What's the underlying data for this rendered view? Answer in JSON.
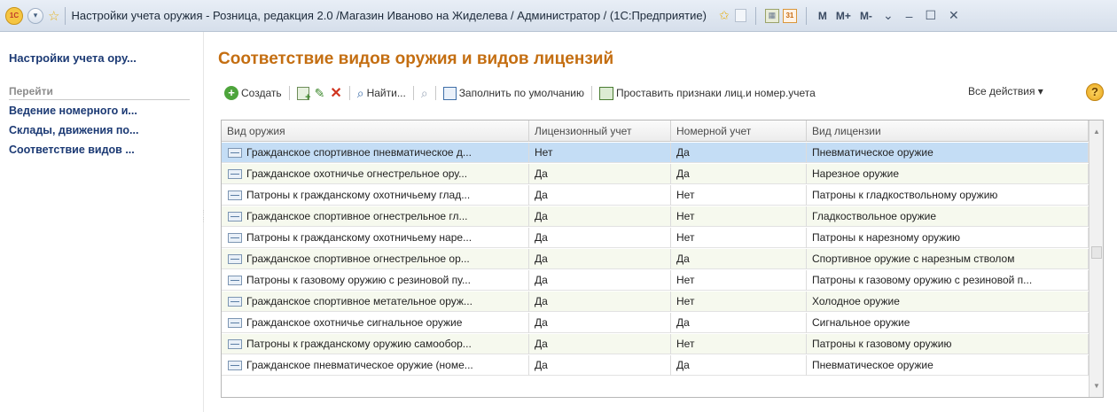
{
  "window": {
    "title": "Настройки учета оружия - Розница, редакция 2.0 /Магазин Иваново на Жиделева / Администратор / (1С:Предприятие)",
    "logo_text": "1С",
    "mem_buttons": [
      "M",
      "M+",
      "M-"
    ]
  },
  "sidebar": {
    "title": "Настройки учета ору...",
    "goto_label": "Перейти",
    "links": [
      "Ведение номерного и...",
      "Склады, движения по...",
      "Соответствие видов ..."
    ]
  },
  "main": {
    "heading": "Соответствие видов оружия и видов лицензий",
    "toolbar": {
      "create": "Создать",
      "find": "Найти...",
      "fill_default": "Заполнить по умолчанию",
      "set_marks": "Проставить признаки лиц.и номер.учета",
      "all_actions": "Все действия ▾",
      "help": "?"
    },
    "columns": [
      "Вид оружия",
      "Лицензионный учет",
      "Номерной учет",
      "Вид лицензии"
    ],
    "rows": [
      [
        "Гражданское спортивное пневматическое д...",
        "Нет",
        "Да",
        "Пневматическое оружие"
      ],
      [
        "Гражданское охотничье огнестрельное ору...",
        "Да",
        "Да",
        "Нарезное оружие"
      ],
      [
        "Патроны к гражданскому охотничьему глад...",
        "Да",
        "Нет",
        "Патроны к гладкоствольному оружию"
      ],
      [
        "Гражданское спортивное огнестрельное гл...",
        "Да",
        "Нет",
        "Гладкоствольное оружие"
      ],
      [
        "Патроны к гражданскому охотничьему наре...",
        "Да",
        "Нет",
        "Патроны к нарезному оружию"
      ],
      [
        "Гражданское спортивное огнестрельное ор...",
        "Да",
        "Да",
        "Спортивное оружие с нарезным стволом"
      ],
      [
        "Патроны к газовому оружию с резиновой пу...",
        "Да",
        "Нет",
        "Патроны к газовому оружию с резиновой п..."
      ],
      [
        "Гражданское спортивное метательное оруж...",
        "Да",
        "Нет",
        "Холодное оружие"
      ],
      [
        "Гражданское охотничье сигнальное оружие",
        "Да",
        "Да",
        "Сигнальное оружие"
      ],
      [
        "Патроны к гражданскому оружию самообор...",
        "Да",
        "Нет",
        "Патроны к газовому оружию"
      ],
      [
        "Гражданское пневматическое оружие (номе...",
        "Да",
        "Да",
        "Пневматическое оружие"
      ]
    ],
    "selected_row": 0
  },
  "colors": {
    "heading": "#c46e11",
    "sidebar_link": "#1c3a74",
    "selected_row": "#c4ddf5",
    "alt_row": "#f6f9ee"
  }
}
